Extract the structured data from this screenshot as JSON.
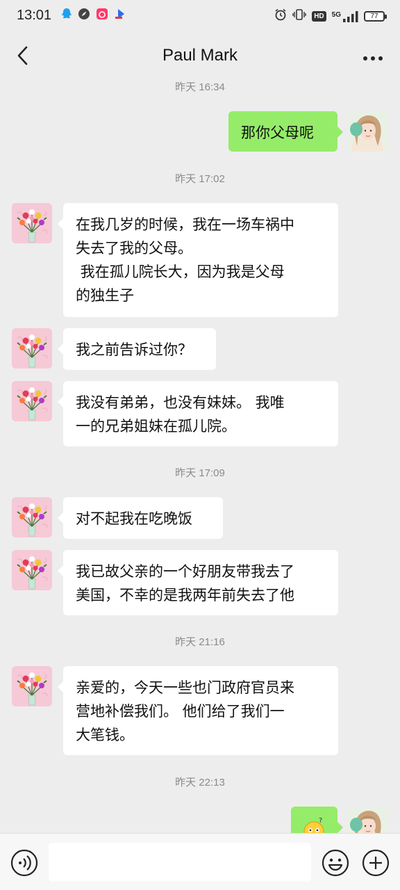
{
  "status_bar": {
    "time": "13:01",
    "left_icons": [
      "qq-icon",
      "compass-icon",
      "app-icon",
      "video-app-icon"
    ],
    "right_icons": [
      "alarm-icon",
      "vibrate-icon",
      "hd-icon",
      "signal-5g-icon"
    ],
    "network": "5G",
    "hd": "HD",
    "battery": "77"
  },
  "navbar": {
    "title": "Paul Mark",
    "back_icon": "chevron-left-icon",
    "more_icon": "more-icon"
  },
  "messages": {
    "ts1": "昨天 16:34",
    "m1": {
      "sender": "me",
      "lines": [
        "那你父母呢"
      ]
    },
    "ts2": "昨天 17:02",
    "m2": {
      "sender": "other",
      "lines": [
        "在我几岁的时候，我在一场车祸中",
        "失去了我的父母。",
        " 我在孤儿院长大，因为我是父母",
        "的独生子"
      ]
    },
    "m3": {
      "sender": "other",
      "lines": [
        "我之前告诉过你？"
      ]
    },
    "m4": {
      "sender": "other",
      "lines": [
        "我没有弟弟，也没有妹妹。 我唯",
        "一的兄弟姐妹在孤儿院。"
      ]
    },
    "ts3": "昨天 17:09",
    "m5": {
      "sender": "other",
      "lines": [
        "对不起我在吃晚饭"
      ]
    },
    "m6": {
      "sender": "other",
      "lines": [
        "我已故父亲的一个好朋友带我去了",
        "美国，不幸的是我两年前失去了他"
      ]
    },
    "ts4": "昨天 21:16",
    "m7": {
      "sender": "other",
      "lines": [
        "亲爱的，今天一些也门政府官员来",
        "营地补偿我们。 他们给了我们一",
        "大笔钱。"
      ]
    },
    "ts5": "昨天 22:13",
    "m8": {
      "sender": "me",
      "content": "thinking-emoji-icon"
    }
  },
  "input_bar": {
    "voice_icon": "voice-icon",
    "input_value": "",
    "emoji_icon": "emoji-icon",
    "plus_icon": "plus-icon"
  },
  "colors": {
    "background": "#ededed",
    "my_bubble": "#95ec69",
    "their_bubble": "#ffffff",
    "timestamp": "#8a8a8a"
  }
}
